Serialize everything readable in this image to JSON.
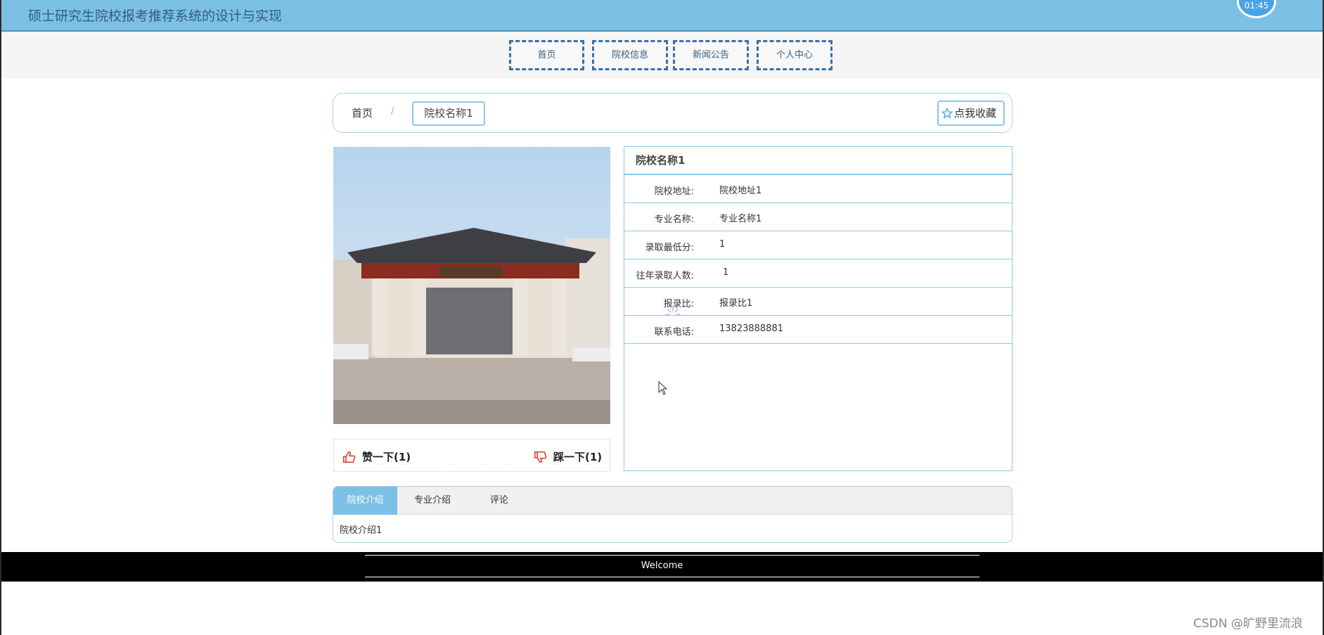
{
  "header": {
    "site_title": "硕士研究生院校报考推荐系统的设计与实现",
    "clock_text": "01:45"
  },
  "nav": {
    "items": [
      {
        "label": "首页"
      },
      {
        "label": "院校信息"
      },
      {
        "label": "新闻公告"
      },
      {
        "label": "个人中心"
      }
    ]
  },
  "breadcrumb": {
    "home": "首页",
    "separator": "/",
    "current": "院校名称1",
    "favorite_button": "点我收藏"
  },
  "vote": {
    "like": "赞一下(1)",
    "dislike": "踩一下(1)"
  },
  "detail": {
    "title": "院校名称1",
    "rows": [
      {
        "label": "院校地址:",
        "value": "院校地址1"
      },
      {
        "label": "专业名称:",
        "value": "专业名称1"
      },
      {
        "label": "录取最低分:",
        "value": "1"
      },
      {
        "label": "往年录取人数:",
        "value": "1"
      },
      {
        "label": "报录比:",
        "value": "报录比1"
      },
      {
        "label": "联系电话:",
        "value": "13823888881"
      }
    ]
  },
  "tabs": {
    "items": [
      {
        "label": "院校介绍"
      },
      {
        "label": "专业介绍"
      },
      {
        "label": "评论"
      }
    ],
    "active_content": "院校介绍1"
  },
  "footer": {
    "text": "Welcome"
  },
  "watermark": "CSDN @旷野里流浪",
  "colors": {
    "header_bg": "#7dc0e6",
    "accent_border": "#8cc6e8",
    "vote_icon": "#e0442b",
    "footer_bg": "#000000"
  }
}
